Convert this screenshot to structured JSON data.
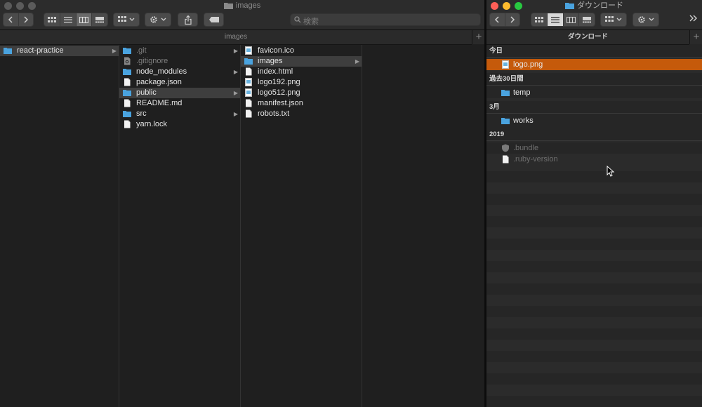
{
  "left_window": {
    "title": "images",
    "path_bar": "images",
    "search_placeholder": "検索",
    "columns": [
      {
        "items": [
          {
            "label": "react-practice",
            "icon": "folder-icon",
            "selected": true,
            "has_children": true
          }
        ]
      },
      {
        "items": [
          {
            "label": ".git",
            "icon": "folder-icon",
            "dim": true,
            "has_children": true
          },
          {
            "label": ".gitignore",
            "icon": "gear-file-icon",
            "dim": true
          },
          {
            "label": "node_modules",
            "icon": "folder-icon",
            "has_children": true
          },
          {
            "label": "package.json",
            "icon": "file-icon"
          },
          {
            "label": "public",
            "icon": "folder-icon",
            "selected": true,
            "has_children": true
          },
          {
            "label": "README.md",
            "icon": "file-icon"
          },
          {
            "label": "src",
            "icon": "folder-icon",
            "has_children": true
          },
          {
            "label": "yarn.lock",
            "icon": "file-icon"
          }
        ]
      },
      {
        "items": [
          {
            "label": "favicon.ico",
            "icon": "image-file-icon"
          },
          {
            "label": "images",
            "icon": "folder-icon",
            "selected": true,
            "has_children": true
          },
          {
            "label": "index.html",
            "icon": "file-icon"
          },
          {
            "label": "logo192.png",
            "icon": "image-file-icon"
          },
          {
            "label": "logo512.png",
            "icon": "image-file-icon"
          },
          {
            "label": "manifest.json",
            "icon": "file-icon"
          },
          {
            "label": "robots.txt",
            "icon": "file-icon"
          }
        ]
      },
      {
        "items": []
      }
    ]
  },
  "right_window": {
    "title": "ダウンロード",
    "column_header": "ダウンロード",
    "groups": [
      {
        "heading": "今日",
        "items": [
          {
            "label": "logo.png",
            "icon": "image-file-icon",
            "highlighted": true
          }
        ]
      },
      {
        "heading": "過去30日間",
        "items": [
          {
            "label": "temp",
            "icon": "folder-icon"
          }
        ]
      },
      {
        "heading": "3月",
        "items": [
          {
            "label": "works",
            "icon": "folder-icon"
          }
        ]
      },
      {
        "heading": "2019",
        "items": [
          {
            "label": ".bundle",
            "icon": "shield-icon",
            "dim": true
          },
          {
            "label": ".ruby-version",
            "icon": "file-icon",
            "dim": true
          }
        ]
      }
    ]
  },
  "colors": {
    "selection": "#3e3e3e",
    "highlight": "#c55a0b",
    "folder": "#4aa3df"
  }
}
